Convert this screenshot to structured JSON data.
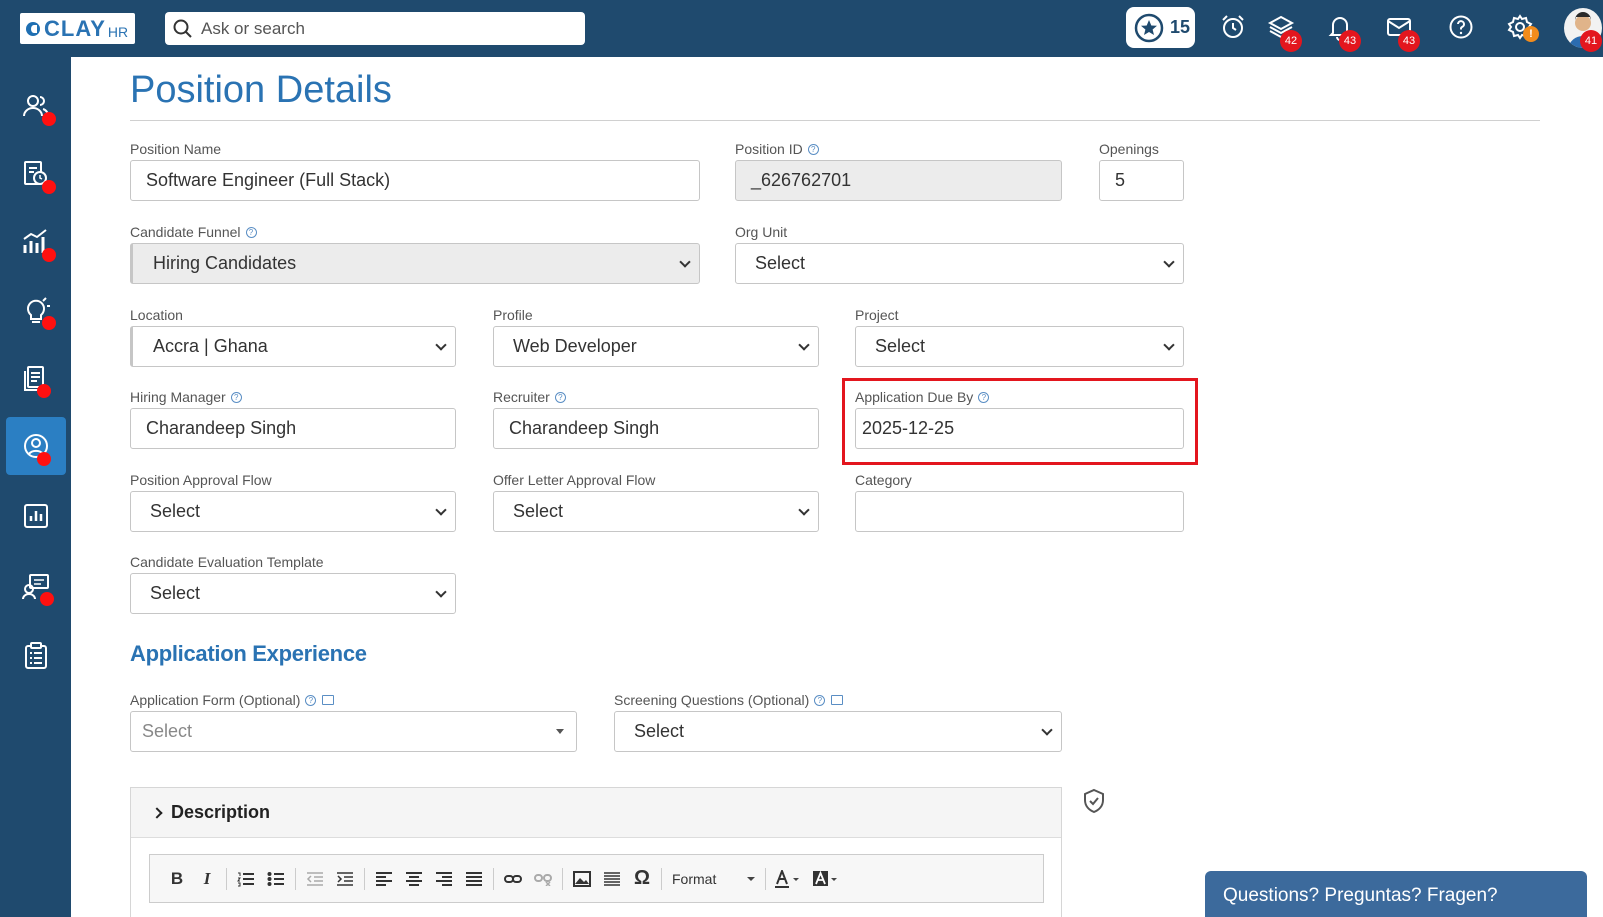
{
  "brand": {
    "name": "CLAY",
    "suffix": "HR"
  },
  "search": {
    "placeholder": "Ask or search"
  },
  "topbar": {
    "star_count": "15",
    "layers_badge": "42",
    "notifications_badge": "43",
    "messages_badge": "43",
    "settings_badge": "!",
    "avatar_badge": "41"
  },
  "page": {
    "title": "Position Details"
  },
  "form": {
    "position_name": {
      "label": "Position Name",
      "value": "Software Engineer (Full Stack)"
    },
    "position_id": {
      "label": "Position ID",
      "value": "_626762701"
    },
    "openings": {
      "label": "Openings",
      "value": "5"
    },
    "candidate_funnel": {
      "label": "Candidate Funnel",
      "value": "Hiring Candidates"
    },
    "org_unit": {
      "label": "Org Unit",
      "value": "Select"
    },
    "location": {
      "label": "Location",
      "value": "Accra | Ghana"
    },
    "profile": {
      "label": "Profile",
      "value": "Web Developer"
    },
    "project": {
      "label": "Project",
      "value": "Select"
    },
    "hiring_manager": {
      "label": "Hiring Manager",
      "value": "Charandeep Singh"
    },
    "recruiter": {
      "label": "Recruiter",
      "value": "Charandeep Singh"
    },
    "application_due_by": {
      "label": "Application Due By",
      "value": "2025-12-25"
    },
    "position_approval_flow": {
      "label": "Position Approval Flow",
      "value": "Select"
    },
    "offer_letter_approval_flow": {
      "label": "Offer Letter Approval Flow",
      "value": "Select"
    },
    "category": {
      "label": "Category",
      "value": ""
    },
    "candidate_evaluation_template": {
      "label": "Candidate Evaluation Template",
      "value": "Select"
    }
  },
  "application_experience": {
    "title": "Application Experience",
    "application_form": {
      "label": "Application Form (Optional)",
      "placeholder": "Select"
    },
    "screening_questions": {
      "label": "Screening Questions (Optional)",
      "value": "Select"
    }
  },
  "description": {
    "title": "Description",
    "toolbar": {
      "format_label": "Format"
    }
  },
  "chat": {
    "label": "Questions? Preguntas? Fragen?"
  },
  "colors": {
    "topbar": "#1f4a6e",
    "accent": "#2a73b3",
    "badge": "#e3161e",
    "highlight": "#e3161e"
  }
}
